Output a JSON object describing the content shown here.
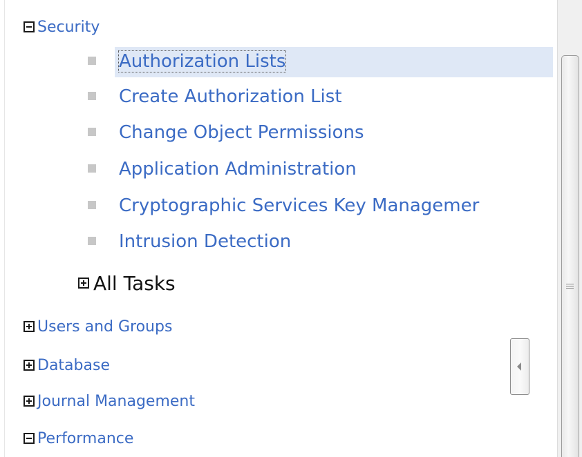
{
  "tree": {
    "security": {
      "label": "Security",
      "toggle": "collapse-icon",
      "tasks": [
        {
          "label": "Authorization Lists",
          "selected": true
        },
        {
          "label": "Create Authorization List"
        },
        {
          "label": "Change Object Permissions"
        },
        {
          "label": "Application Administration"
        },
        {
          "label": "Cryptographic Services Key Managemer"
        },
        {
          "label": "Intrusion Detection"
        }
      ],
      "all_tasks": {
        "label": "All Tasks",
        "toggle": "expand-icon"
      }
    },
    "categories": [
      {
        "label": "Users and Groups",
        "toggle": "expand-icon"
      },
      {
        "label": "Database",
        "toggle": "expand-icon"
      },
      {
        "label": "Journal Management",
        "toggle": "expand-icon"
      },
      {
        "label": "Performance",
        "toggle": "collapse-icon"
      }
    ]
  },
  "colors": {
    "link": "#3b6bc4",
    "selection": "#dfe8f6",
    "bullet": "#c7c7c7"
  }
}
